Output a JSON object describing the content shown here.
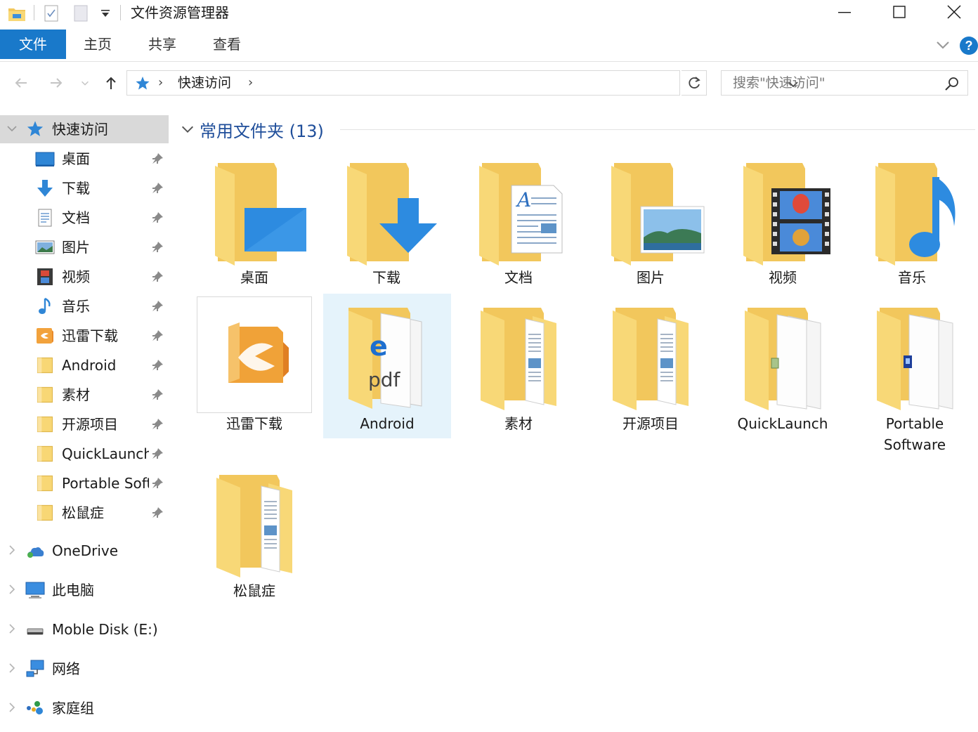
{
  "window": {
    "title": "文件资源管理器",
    "quick_access_dropdown": "▾"
  },
  "ribbon": {
    "tabs": [
      {
        "label": "文件"
      },
      {
        "label": "主页"
      },
      {
        "label": "共享"
      },
      {
        "label": "查看"
      }
    ],
    "help": "?"
  },
  "nav": {
    "breadcrumb": "快速访问",
    "search_placeholder": "搜索\"快速访问\""
  },
  "sidebar": {
    "quick_access": "快速访问",
    "pinned": [
      {
        "label": "桌面"
      },
      {
        "label": "下载"
      },
      {
        "label": "文档"
      },
      {
        "label": "图片"
      },
      {
        "label": "视频"
      },
      {
        "label": "音乐"
      },
      {
        "label": "迅雷下载"
      },
      {
        "label": "Android"
      },
      {
        "label": "素材"
      },
      {
        "label": "开源项目"
      },
      {
        "label": "QuickLaunch"
      },
      {
        "label": "Portable Software"
      },
      {
        "label": "松鼠症"
      }
    ],
    "roots": [
      {
        "label": "OneDrive"
      },
      {
        "label": "此电脑"
      },
      {
        "label": "Moble Disk (E:)"
      },
      {
        "label": "网络"
      },
      {
        "label": "家庭组"
      }
    ]
  },
  "main": {
    "group_title": "常用文件夹 (13)",
    "folders": [
      {
        "label": "桌面"
      },
      {
        "label": "下载"
      },
      {
        "label": "文档"
      },
      {
        "label": "图片"
      },
      {
        "label": "视频"
      },
      {
        "label": "音乐"
      },
      {
        "label": "迅雷下载"
      },
      {
        "label": "Android"
      },
      {
        "label": "素材"
      },
      {
        "label": "开源项目"
      },
      {
        "label": "QuickLaunch"
      },
      {
        "label": "Portable",
        "label2": "Software"
      },
      {
        "label": "松鼠症"
      }
    ]
  },
  "colors": {
    "accent": "#1979ca",
    "folder_yellow": "#f8d775",
    "selection": "#e5f3fb",
    "header_blue": "#1f4e9a"
  }
}
